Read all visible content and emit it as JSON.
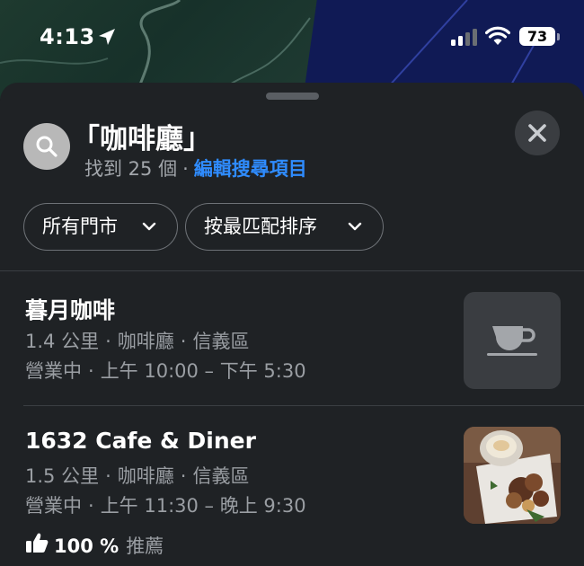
{
  "status_bar": {
    "time": "4:13",
    "battery": "73"
  },
  "search": {
    "query": "「咖啡廳」",
    "result_count": "找到 25 個",
    "separator": "·",
    "edit_link": "編輯搜尋項目"
  },
  "filters": [
    {
      "label": "所有門市"
    },
    {
      "label": "按最匹配排序"
    }
  ],
  "results": [
    {
      "name": "暮月咖啡",
      "distance": "1.4 公里",
      "category": "咖啡廳",
      "district": "信義區",
      "status": "營業中",
      "hours": "上午 10:00 – 下午 5:30"
    },
    {
      "name": "1632 Cafe & Diner",
      "distance": "1.5 公里",
      "category": "咖啡廳",
      "district": "信義區",
      "status": "營業中",
      "hours": "上午 11:30 – 晚上 9:30",
      "recommend_percent": "100 %",
      "recommend_label": "推薦"
    }
  ],
  "colors": {
    "accent": "#2f8cff",
    "sheet": "#1f2225",
    "secondary_text": "#9a9ea3",
    "map_water": "#101a55",
    "map_land": "#1e3a2f"
  },
  "icons": [
    "location-arrow-icon",
    "cellular-signal-icon",
    "wifi-icon",
    "battery-icon",
    "search-icon",
    "close-icon",
    "chevron-down-icon",
    "coffee-cup-icon",
    "thumbs-up-icon"
  ]
}
